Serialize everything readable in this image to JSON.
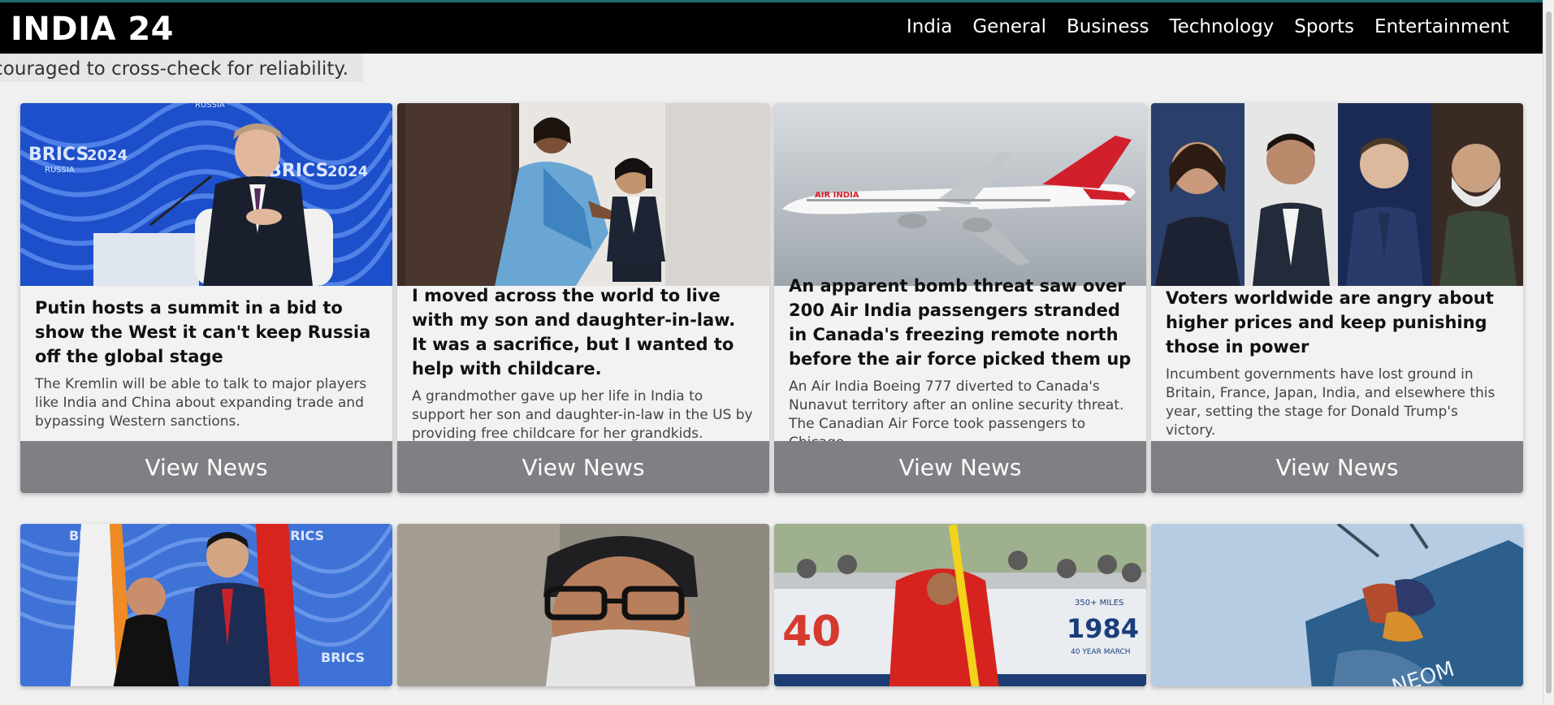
{
  "brand": "INDIA 24",
  "nav": [
    "India",
    "General",
    "Business",
    "Technology",
    "Sports",
    "Entertainment"
  ],
  "ticker": "couraged to cross-check for reliability.",
  "cards": [
    {
      "title": "Putin hosts a summit in a bid to show the West it can't keep Russia off the global stage",
      "desc": "The Kremlin will be able to talk to major players like India and China about expanding trade and bypassing Western sanctions.",
      "button": "View News"
    },
    {
      "title": "I moved across the world to live with my son and daughter-in-law. It was a sacrifice, but I wanted to help with childcare.",
      "desc": "A grandmother gave up her life in India to support her son and daughter-in-law in the US by providing free childcare for her grandkids.",
      "button": "View News"
    },
    {
      "title": "An apparent bomb threat saw over 200 Air India passengers stranded in Canada's freezing remote north before the air force picked them up",
      "desc": "An Air India Boeing 777 diverted to Canada's Nunavut territory after an online security threat. The Canadian Air Force took passengers to Chicago.",
      "button": "View News"
    },
    {
      "title": "Voters worldwide are angry about higher prices and keep punishing those in power",
      "desc": "Incumbent governments have lost ground in Britain, France, Japan, India, and elsewhere this year, setting the stage for Donald Trump's victory.",
      "button": "View News"
    }
  ],
  "image_text": {
    "brics": "BRICS",
    "brics_year": "2024",
    "russia": "RUSSIA",
    "airline": "AIR INDIA",
    "neom": "NEOM",
    "banner_num1": "40",
    "banner_year": "1984",
    "banner_sub": "40 YEAR MARCH",
    "banner_miles": "350+ MILES"
  },
  "colors": {
    "navbar": "#000000",
    "button": "#7f7f84",
    "accent_line": "#1a6b6b"
  }
}
